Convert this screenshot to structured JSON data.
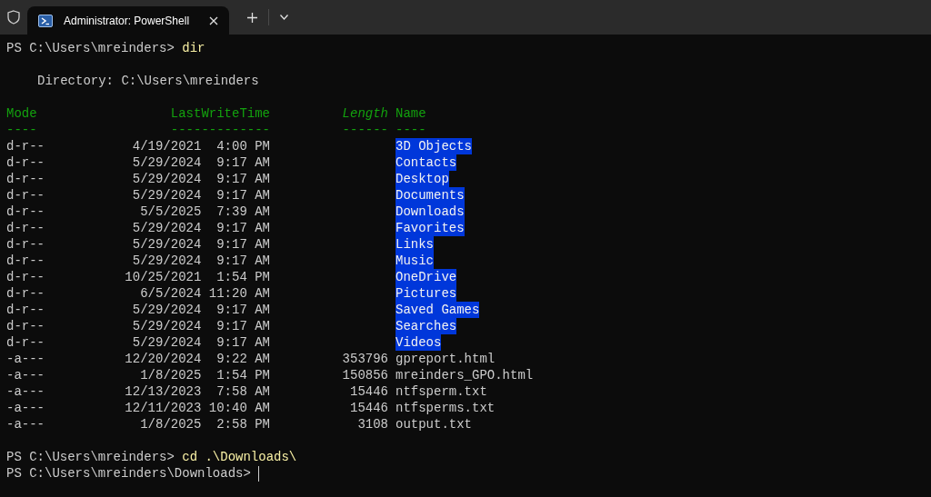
{
  "tab": {
    "title": "Administrator: PowerShell",
    "selected": true
  },
  "first_prompt": {
    "prompt": "PS C:\\Users\\mreinders>",
    "command": "dir"
  },
  "directory_line": "Directory: C:\\Users\\mreinders",
  "table": {
    "columns": [
      {
        "label": "Mode",
        "rule": "----",
        "italic": false
      },
      {
        "label": "LastWriteTime",
        "rule": "-------------",
        "italic": false
      },
      {
        "label": "Length",
        "rule": "------",
        "italic": true
      },
      {
        "label": "Name",
        "rule": "----",
        "italic": false
      }
    ],
    "rows": [
      {
        "kind": "directory",
        "mode": "d-r--",
        "last_write": "4/19/2021  4:00 PM",
        "name": "3D Objects"
      },
      {
        "kind": "directory",
        "mode": "d-r--",
        "last_write": "5/29/2024  9:17 AM",
        "name": "Contacts"
      },
      {
        "kind": "directory",
        "mode": "d-r--",
        "last_write": "5/29/2024  9:17 AM",
        "name": "Desktop"
      },
      {
        "kind": "directory",
        "mode": "d-r--",
        "last_write": "5/29/2024  9:17 AM",
        "name": "Documents"
      },
      {
        "kind": "directory",
        "mode": "d-r--",
        "last_write": "5/5/2025  7:39 AM",
        "name": "Downloads"
      },
      {
        "kind": "directory",
        "mode": "d-r--",
        "last_write": "5/29/2024  9:17 AM",
        "name": "Favorites"
      },
      {
        "kind": "directory",
        "mode": "d-r--",
        "last_write": "5/29/2024  9:17 AM",
        "name": "Links"
      },
      {
        "kind": "directory",
        "mode": "d-r--",
        "last_write": "5/29/2024  9:17 AM",
        "name": "Music"
      },
      {
        "kind": "directory",
        "mode": "d-r--",
        "last_write": "10/25/2021  1:54 PM",
        "name": "OneDrive"
      },
      {
        "kind": "directory",
        "mode": "d-r--",
        "last_write": "6/5/2024 11:20 AM",
        "name": "Pictures"
      },
      {
        "kind": "directory",
        "mode": "d-r--",
        "last_write": "5/29/2024  9:17 AM",
        "name": "Saved Games"
      },
      {
        "kind": "directory",
        "mode": "d-r--",
        "last_write": "5/29/2024  9:17 AM",
        "name": "Searches"
      },
      {
        "kind": "directory",
        "mode": "d-r--",
        "last_write": "5/29/2024  9:17 AM",
        "name": "Videos"
      },
      {
        "kind": "file",
        "mode": "-a---",
        "last_write": "12/20/2024  9:22 AM",
        "length": "353796",
        "name": "gpreport.html"
      },
      {
        "kind": "file",
        "mode": "-a---",
        "last_write": "1/8/2025  1:54 PM",
        "length": "150856",
        "name": "mreinders_GPO.html"
      },
      {
        "kind": "file",
        "mode": "-a---",
        "last_write": "12/13/2023  7:58 AM",
        "length": "15446",
        "name": "ntfsperm.txt"
      },
      {
        "kind": "file",
        "mode": "-a---",
        "last_write": "12/11/2023 10:40 AM",
        "length": "15446",
        "name": "ntfsperms.txt"
      },
      {
        "kind": "file",
        "mode": "-a---",
        "last_write": "1/8/2025  2:58 PM",
        "length": "3108",
        "name": "output.txt"
      }
    ]
  },
  "second_prompt": {
    "prompt": "PS C:\\Users\\mreinders>",
    "command": "cd .\\Downloads\\"
  },
  "current_prompt": {
    "prompt": "PS C:\\Users\\mreinders\\Downloads>"
  }
}
